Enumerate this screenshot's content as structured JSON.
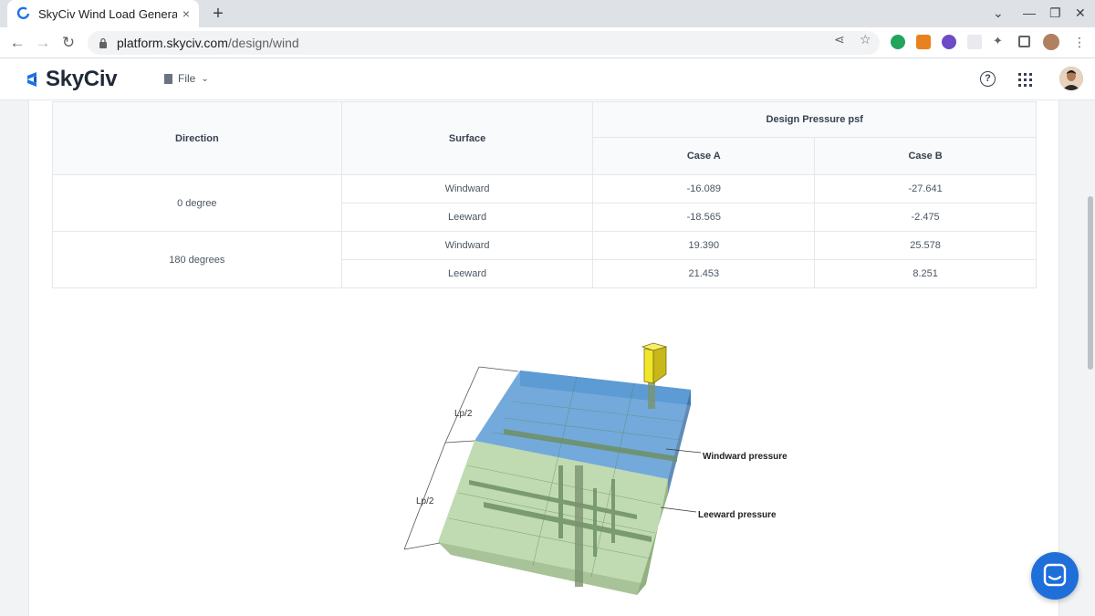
{
  "browser": {
    "tab_title": "SkyCiv Wind Load Genera",
    "tab_close": "×",
    "new_tab": "+",
    "url_host": "platform.skyciv.com",
    "url_path": "/design/wind"
  },
  "app": {
    "logo_text": "SkyCiv",
    "file_menu": "File"
  },
  "table": {
    "headers": {
      "direction": "Direction",
      "surface": "Surface",
      "design_pressure": "Design Pressure psf",
      "case_a": "Case A",
      "case_b": "Case B"
    },
    "groups": [
      {
        "direction": "0 degree",
        "rows": [
          {
            "surface": "Windward",
            "case_a": "-16.089",
            "case_b": "-27.641"
          },
          {
            "surface": "Leeward",
            "case_a": "-18.565",
            "case_b": "-2.475"
          }
        ]
      },
      {
        "direction": "180 degrees",
        "rows": [
          {
            "surface": "Windward",
            "case_a": "19.390",
            "case_b": "25.578"
          },
          {
            "surface": "Leeward",
            "case_a": "21.453",
            "case_b": "8.251"
          }
        ]
      }
    ]
  },
  "diagram": {
    "label_lp_top": "Lp/2",
    "label_lp_bottom": "Lp/2",
    "label_windward": "Windward pressure",
    "label_leeward": "Leeward pressure"
  },
  "colors": {
    "windward": "#5b9bd5",
    "leeward": "#b5d3a3",
    "accent": "#1e6fd9"
  }
}
